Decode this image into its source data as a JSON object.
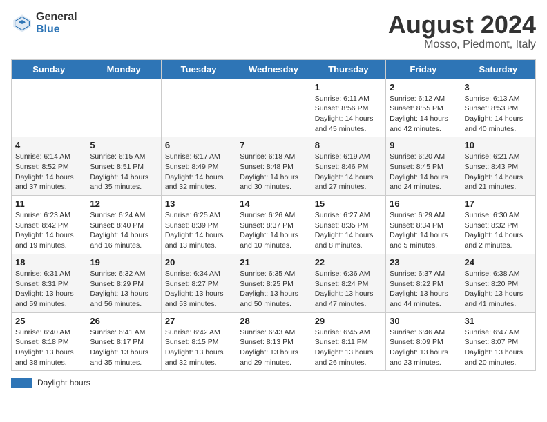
{
  "header": {
    "logo_general": "General",
    "logo_blue": "Blue",
    "title": "August 2024",
    "location": "Mosso, Piedmont, Italy"
  },
  "days_of_week": [
    "Sunday",
    "Monday",
    "Tuesday",
    "Wednesday",
    "Thursday",
    "Friday",
    "Saturday"
  ],
  "weeks": [
    [
      {
        "date": "",
        "sunrise": "",
        "sunset": "",
        "daylight": ""
      },
      {
        "date": "",
        "sunrise": "",
        "sunset": "",
        "daylight": ""
      },
      {
        "date": "",
        "sunrise": "",
        "sunset": "",
        "daylight": ""
      },
      {
        "date": "",
        "sunrise": "",
        "sunset": "",
        "daylight": ""
      },
      {
        "date": "1",
        "sunrise": "Sunrise: 6:11 AM",
        "sunset": "Sunset: 8:56 PM",
        "daylight": "Daylight: 14 hours and 45 minutes."
      },
      {
        "date": "2",
        "sunrise": "Sunrise: 6:12 AM",
        "sunset": "Sunset: 8:55 PM",
        "daylight": "Daylight: 14 hours and 42 minutes."
      },
      {
        "date": "3",
        "sunrise": "Sunrise: 6:13 AM",
        "sunset": "Sunset: 8:53 PM",
        "daylight": "Daylight: 14 hours and 40 minutes."
      }
    ],
    [
      {
        "date": "4",
        "sunrise": "Sunrise: 6:14 AM",
        "sunset": "Sunset: 8:52 PM",
        "daylight": "Daylight: 14 hours and 37 minutes."
      },
      {
        "date": "5",
        "sunrise": "Sunrise: 6:15 AM",
        "sunset": "Sunset: 8:51 PM",
        "daylight": "Daylight: 14 hours and 35 minutes."
      },
      {
        "date": "6",
        "sunrise": "Sunrise: 6:17 AM",
        "sunset": "Sunset: 8:49 PM",
        "daylight": "Daylight: 14 hours and 32 minutes."
      },
      {
        "date": "7",
        "sunrise": "Sunrise: 6:18 AM",
        "sunset": "Sunset: 8:48 PM",
        "daylight": "Daylight: 14 hours and 30 minutes."
      },
      {
        "date": "8",
        "sunrise": "Sunrise: 6:19 AM",
        "sunset": "Sunset: 8:46 PM",
        "daylight": "Daylight: 14 hours and 27 minutes."
      },
      {
        "date": "9",
        "sunrise": "Sunrise: 6:20 AM",
        "sunset": "Sunset: 8:45 PM",
        "daylight": "Daylight: 14 hours and 24 minutes."
      },
      {
        "date": "10",
        "sunrise": "Sunrise: 6:21 AM",
        "sunset": "Sunset: 8:43 PM",
        "daylight": "Daylight: 14 hours and 21 minutes."
      }
    ],
    [
      {
        "date": "11",
        "sunrise": "Sunrise: 6:23 AM",
        "sunset": "Sunset: 8:42 PM",
        "daylight": "Daylight: 14 hours and 19 minutes."
      },
      {
        "date": "12",
        "sunrise": "Sunrise: 6:24 AM",
        "sunset": "Sunset: 8:40 PM",
        "daylight": "Daylight: 14 hours and 16 minutes."
      },
      {
        "date": "13",
        "sunrise": "Sunrise: 6:25 AM",
        "sunset": "Sunset: 8:39 PM",
        "daylight": "Daylight: 14 hours and 13 minutes."
      },
      {
        "date": "14",
        "sunrise": "Sunrise: 6:26 AM",
        "sunset": "Sunset: 8:37 PM",
        "daylight": "Daylight: 14 hours and 10 minutes."
      },
      {
        "date": "15",
        "sunrise": "Sunrise: 6:27 AM",
        "sunset": "Sunset: 8:35 PM",
        "daylight": "Daylight: 14 hours and 8 minutes."
      },
      {
        "date": "16",
        "sunrise": "Sunrise: 6:29 AM",
        "sunset": "Sunset: 8:34 PM",
        "daylight": "Daylight: 14 hours and 5 minutes."
      },
      {
        "date": "17",
        "sunrise": "Sunrise: 6:30 AM",
        "sunset": "Sunset: 8:32 PM",
        "daylight": "Daylight: 14 hours and 2 minutes."
      }
    ],
    [
      {
        "date": "18",
        "sunrise": "Sunrise: 6:31 AM",
        "sunset": "Sunset: 8:31 PM",
        "daylight": "Daylight: 13 hours and 59 minutes."
      },
      {
        "date": "19",
        "sunrise": "Sunrise: 6:32 AM",
        "sunset": "Sunset: 8:29 PM",
        "daylight": "Daylight: 13 hours and 56 minutes."
      },
      {
        "date": "20",
        "sunrise": "Sunrise: 6:34 AM",
        "sunset": "Sunset: 8:27 PM",
        "daylight": "Daylight: 13 hours and 53 minutes."
      },
      {
        "date": "21",
        "sunrise": "Sunrise: 6:35 AM",
        "sunset": "Sunset: 8:25 PM",
        "daylight": "Daylight: 13 hours and 50 minutes."
      },
      {
        "date": "22",
        "sunrise": "Sunrise: 6:36 AM",
        "sunset": "Sunset: 8:24 PM",
        "daylight": "Daylight: 13 hours and 47 minutes."
      },
      {
        "date": "23",
        "sunrise": "Sunrise: 6:37 AM",
        "sunset": "Sunset: 8:22 PM",
        "daylight": "Daylight: 13 hours and 44 minutes."
      },
      {
        "date": "24",
        "sunrise": "Sunrise: 6:38 AM",
        "sunset": "Sunset: 8:20 PM",
        "daylight": "Daylight: 13 hours and 41 minutes."
      }
    ],
    [
      {
        "date": "25",
        "sunrise": "Sunrise: 6:40 AM",
        "sunset": "Sunset: 8:18 PM",
        "daylight": "Daylight: 13 hours and 38 minutes."
      },
      {
        "date": "26",
        "sunrise": "Sunrise: 6:41 AM",
        "sunset": "Sunset: 8:17 PM",
        "daylight": "Daylight: 13 hours and 35 minutes."
      },
      {
        "date": "27",
        "sunrise": "Sunrise: 6:42 AM",
        "sunset": "Sunset: 8:15 PM",
        "daylight": "Daylight: 13 hours and 32 minutes."
      },
      {
        "date": "28",
        "sunrise": "Sunrise: 6:43 AM",
        "sunset": "Sunset: 8:13 PM",
        "daylight": "Daylight: 13 hours and 29 minutes."
      },
      {
        "date": "29",
        "sunrise": "Sunrise: 6:45 AM",
        "sunset": "Sunset: 8:11 PM",
        "daylight": "Daylight: 13 hours and 26 minutes."
      },
      {
        "date": "30",
        "sunrise": "Sunrise: 6:46 AM",
        "sunset": "Sunset: 8:09 PM",
        "daylight": "Daylight: 13 hours and 23 minutes."
      },
      {
        "date": "31",
        "sunrise": "Sunrise: 6:47 AM",
        "sunset": "Sunset: 8:07 PM",
        "daylight": "Daylight: 13 hours and 20 minutes."
      }
    ]
  ],
  "legend": {
    "label": "Daylight hours"
  }
}
